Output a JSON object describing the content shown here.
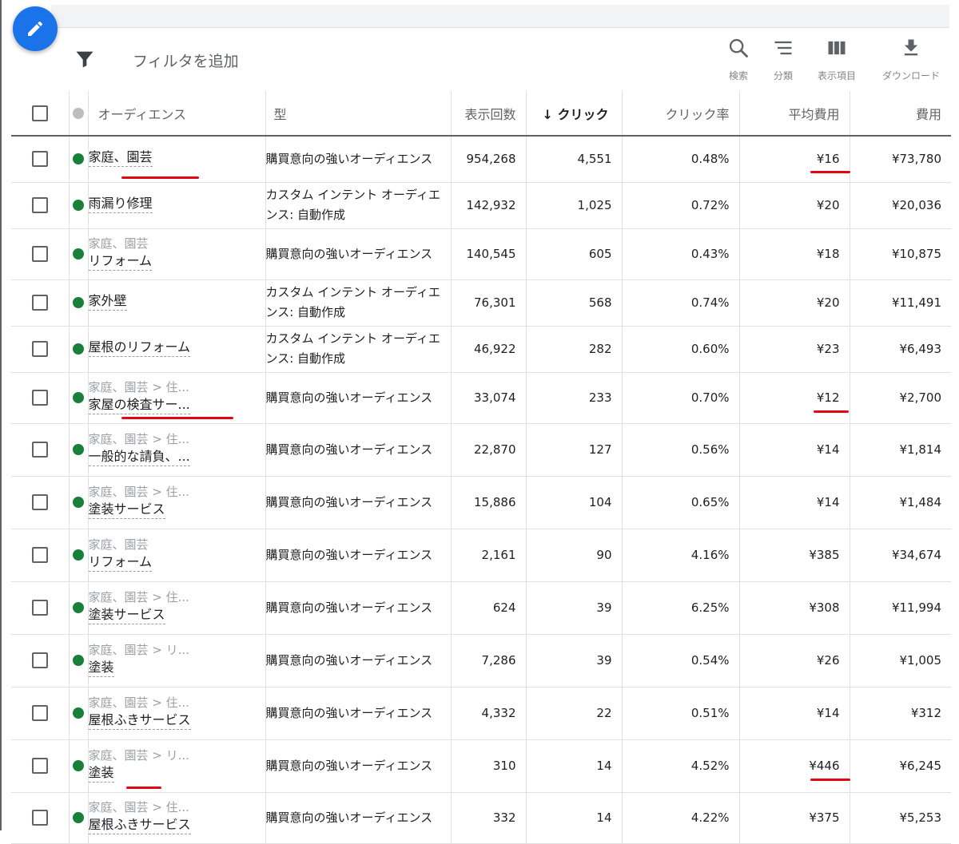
{
  "toolbar": {
    "filter_placeholder": "フィルタを追加",
    "search_label": "検索",
    "segment_label": "分類",
    "columns_label": "表示項目",
    "download_label": "ダウンロード"
  },
  "table": {
    "headers": [
      "オーディエンス",
      "型",
      "表示回数",
      "クリック",
      "クリック率",
      "平均費用",
      "費用"
    ],
    "sorted_column": "クリック",
    "rows": [
      {
        "parent": "",
        "name": "家庭、園芸",
        "type": "購買意向の強いオーディエンス",
        "impressions": "954,268",
        "clicks": "4,551",
        "ctr": "0.48%",
        "avg_cost": "¥16",
        "cost": "¥73,780"
      },
      {
        "parent": "",
        "name": "雨漏り修理",
        "type": "カスタム インテント オーディエンス: 自動作成",
        "impressions": "142,932",
        "clicks": "1,025",
        "ctr": "0.72%",
        "avg_cost": "¥20",
        "cost": "¥20,036"
      },
      {
        "parent": "家庭、園芸",
        "name": "リフォーム",
        "type": "購買意向の強いオーディエンス",
        "impressions": "140,545",
        "clicks": "605",
        "ctr": "0.43%",
        "avg_cost": "¥18",
        "cost": "¥10,875"
      },
      {
        "parent": "",
        "name": "家外壁",
        "type": "カスタム インテント オーディエンス: 自動作成",
        "impressions": "76,301",
        "clicks": "568",
        "ctr": "0.74%",
        "avg_cost": "¥20",
        "cost": "¥11,491"
      },
      {
        "parent": "",
        "name": "屋根のリフォーム",
        "type": "カスタム インテント オーディエンス: 自動作成",
        "impressions": "46,922",
        "clicks": "282",
        "ctr": "0.60%",
        "avg_cost": "¥23",
        "cost": "¥6,493"
      },
      {
        "parent": "家庭、園芸 > 住...",
        "name": "家屋の検査サー...",
        "type": "購買意向の強いオーディエンス",
        "impressions": "33,074",
        "clicks": "233",
        "ctr": "0.70%",
        "avg_cost": "¥12",
        "cost": "¥2,700"
      },
      {
        "parent": "家庭、園芸 > 住...",
        "name": "一般的な請負、...",
        "type": "購買意向の強いオーディエンス",
        "impressions": "22,870",
        "clicks": "127",
        "ctr": "0.56%",
        "avg_cost": "¥14",
        "cost": "¥1,814"
      },
      {
        "parent": "家庭、園芸 > 住...",
        "name": "塗装サービス",
        "type": "購買意向の強いオーディエンス",
        "impressions": "15,886",
        "clicks": "104",
        "ctr": "0.65%",
        "avg_cost": "¥14",
        "cost": "¥1,484"
      },
      {
        "parent": "家庭、園芸",
        "name": "リフォーム",
        "type": "購買意向の強いオーディエンス",
        "impressions": "2,161",
        "clicks": "90",
        "ctr": "4.16%",
        "avg_cost": "¥385",
        "cost": "¥34,674"
      },
      {
        "parent": "家庭、園芸 > 住...",
        "name": "塗装サービス",
        "type": "購買意向の強いオーディエンス",
        "impressions": "624",
        "clicks": "39",
        "ctr": "6.25%",
        "avg_cost": "¥308",
        "cost": "¥11,994"
      },
      {
        "parent": "家庭、園芸 > リ...",
        "name": "塗装",
        "type": "購買意向の強いオーディエンス",
        "impressions": "7,286",
        "clicks": "39",
        "ctr": "0.54%",
        "avg_cost": "¥26",
        "cost": "¥1,005"
      },
      {
        "parent": "家庭、園芸 > 住...",
        "name": "屋根ふきサービス",
        "type": "購買意向の強いオーディエンス",
        "impressions": "4,332",
        "clicks": "22",
        "ctr": "0.51%",
        "avg_cost": "¥14",
        "cost": "¥312"
      },
      {
        "parent": "家庭、園芸 > リ...",
        "name": "塗装",
        "type": "購買意向の強いオーディエンス",
        "impressions": "310",
        "clicks": "14",
        "ctr": "4.52%",
        "avg_cost": "¥446",
        "cost": "¥6,245"
      },
      {
        "parent": "家庭、園芸 > 住...",
        "name": "屋根ふきサービス",
        "type": "購買意向の強いオーディエンス",
        "impressions": "332",
        "clicks": "14",
        "ctr": "4.22%",
        "avg_cost": "¥375",
        "cost": "¥5,253"
      }
    ]
  },
  "colors": {
    "accent": "#1a73e8",
    "status_enabled": "#188038",
    "highlight": "#e30613"
  }
}
